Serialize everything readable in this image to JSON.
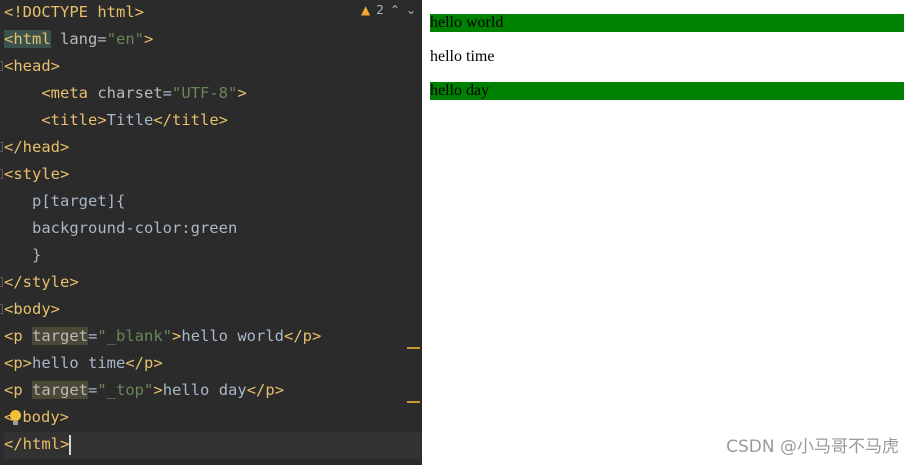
{
  "editor": {
    "warning_count": "2",
    "lines": {
      "l1": "<!DOCTYPE html>",
      "l2_tag": "<html",
      "l2_attr": " lang",
      "l2_eq": "=",
      "l2_val": "\"en\"",
      "l2_end": ">",
      "l3": "<head>",
      "l4_indent": "    ",
      "l4_tag": "<meta",
      "l4_attr": " charset",
      "l4_eq": "=",
      "l4_val": "\"UTF-8\"",
      "l4_end": ">",
      "l5_indent": "    ",
      "l5_open": "<title>",
      "l5_text": "Title",
      "l5_close": "</title>",
      "l6": "</head>",
      "l7": "<style>",
      "l8": "   p[target]{",
      "l9": "   background-color:green",
      "l10": "   }",
      "l11": "</style>",
      "l12": "<body>",
      "l13_tag": "<p",
      "l13_attr": "target",
      "l13_eq": "=",
      "l13_val": "\"_blank\"",
      "l13_end": ">",
      "l13_text": "hello world",
      "l13_close": "</p>",
      "l14_open": "<p>",
      "l14_text": "hello time",
      "l14_close": "</p>",
      "l15_tag": "<p",
      "l15_attr": "target",
      "l15_eq": "=",
      "l15_val": "\"_top\"",
      "l15_end": ">",
      "l15_text": "hello day",
      "l15_close": "</p>",
      "l16_a": "<",
      "l16_b": "body>",
      "l17": "</html>"
    }
  },
  "preview": {
    "p1": "hello world",
    "p2": "hello time",
    "p3": "hello day"
  },
  "watermark": "CSDN @小马哥不马虎",
  "colors": {
    "editor_bg": "#2b2b2b",
    "tag": "#e8bf6a",
    "attr_value": "#6a8759",
    "green": "#008000"
  }
}
